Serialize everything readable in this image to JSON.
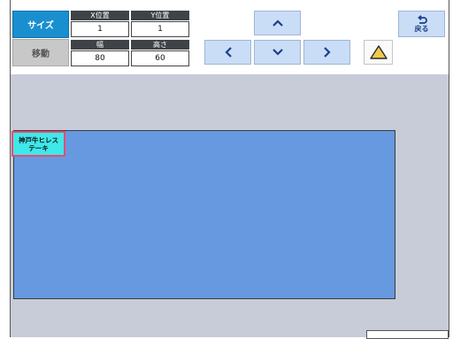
{
  "mode": {
    "size_label": "サイズ",
    "move_label": "移動"
  },
  "fields": {
    "x_position": {
      "label": "X位置",
      "value": "1"
    },
    "y_position": {
      "label": "Y位置",
      "value": "1"
    },
    "width": {
      "label": "幅",
      "value": "80"
    },
    "height": {
      "label": "高さ",
      "value": "60"
    }
  },
  "nav": {
    "back_label": "戻る"
  },
  "canvas": {
    "item_lines": [
      "神戸牛ヒレス",
      "テーキ"
    ]
  },
  "colors": {
    "size_button": "#1a8fd0",
    "canvas_fill": "#6699e0",
    "item_fill": "#3fe8ea",
    "item_border": "#e94b73",
    "warning": "#f2c94c"
  },
  "icons": {
    "up": "chevron-up-icon",
    "down": "chevron-down-icon",
    "left": "chevron-left-icon",
    "right": "chevron-right-icon",
    "warning": "warning-icon",
    "back": "return-arrow-icon"
  }
}
